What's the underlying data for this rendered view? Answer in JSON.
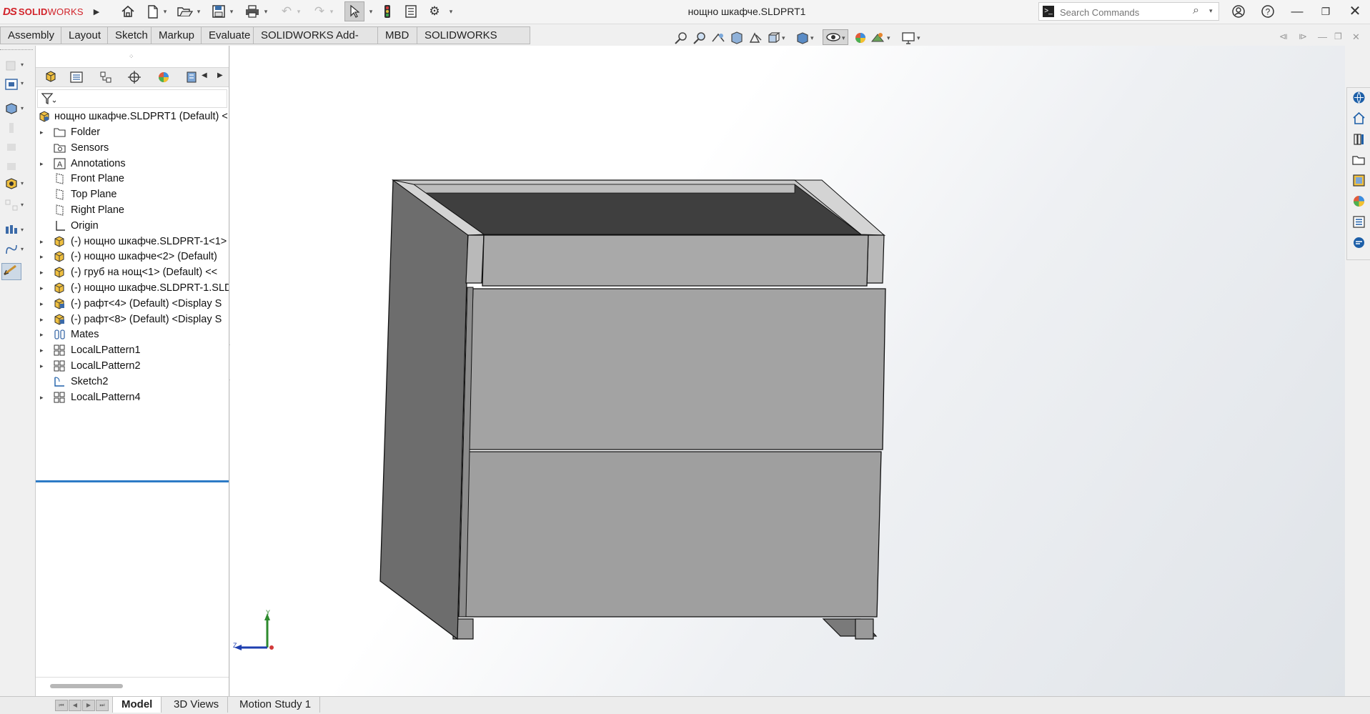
{
  "app": {
    "logo_mark": "DS",
    "logo_text_bold": "SOLID",
    "logo_text_light": "WORKS"
  },
  "window": {
    "title": "нощно шкафче.SLDPRT1"
  },
  "search": {
    "placeholder": "Search Commands"
  },
  "command_tabs": [
    "Assembly",
    "Layout",
    "Sketch",
    "Markup",
    "Evaluate",
    "SOLIDWORKS Add-Ins",
    "MBD",
    "SOLIDWORKS CAM"
  ],
  "tree": {
    "root": "нощно шкафче.SLDPRT1 (Default) <",
    "items": [
      {
        "label": "Folder",
        "icon": "folder-icon",
        "expandable": true
      },
      {
        "label": "Sensors",
        "icon": "sensors-icon",
        "expandable": false
      },
      {
        "label": "Annotations",
        "icon": "annotations-icon",
        "expandable": true
      },
      {
        "label": "Front Plane",
        "icon": "plane-icon",
        "expandable": false
      },
      {
        "label": "Top Plane",
        "icon": "plane-icon",
        "expandable": false
      },
      {
        "label": "Right Plane",
        "icon": "plane-icon",
        "expandable": false
      },
      {
        "label": "Origin",
        "icon": "origin-icon",
        "expandable": false
      },
      {
        "label": "(-) нощно шкафче.SLDPRT-1<1>",
        "icon": "part-icon",
        "expandable": true
      },
      {
        "label": "(-) нощно шкафче<2> (Default)",
        "icon": "part-icon",
        "expandable": true
      },
      {
        "label": "(-) груб на нощ<1> (Default) <<",
        "icon": "part-icon",
        "expandable": true
      },
      {
        "label": "(-) нощно шкафче.SLDPRT-1.SLD",
        "icon": "part-icon",
        "expandable": true
      },
      {
        "label": "(-) рафт<4> (Default) <Display S",
        "icon": "part-blue-icon",
        "expandable": true
      },
      {
        "label": "(-) рафт<8> (Default) <Display S",
        "icon": "part-blue-icon",
        "expandable": true
      },
      {
        "label": "Mates",
        "icon": "mates-icon",
        "expandable": true
      },
      {
        "label": "LocalLPattern1",
        "icon": "pattern-icon",
        "expandable": true
      },
      {
        "label": "LocalLPattern2",
        "icon": "pattern-icon",
        "expandable": true
      },
      {
        "label": "Sketch2",
        "icon": "sketch-icon",
        "expandable": false
      },
      {
        "label": "LocalLPattern4",
        "icon": "pattern-icon",
        "expandable": true
      }
    ]
  },
  "triad": {
    "y": "Y",
    "z": "Z"
  },
  "bottom_tabs": [
    "Model",
    "3D Views",
    "Motion Study 1"
  ],
  "active_bottom_tab": "Model",
  "colors": {
    "brand": "#d2232a",
    "selection": "#2d7bc6",
    "model_face": "#a3a3a3",
    "model_side": "#6d6d6d"
  }
}
